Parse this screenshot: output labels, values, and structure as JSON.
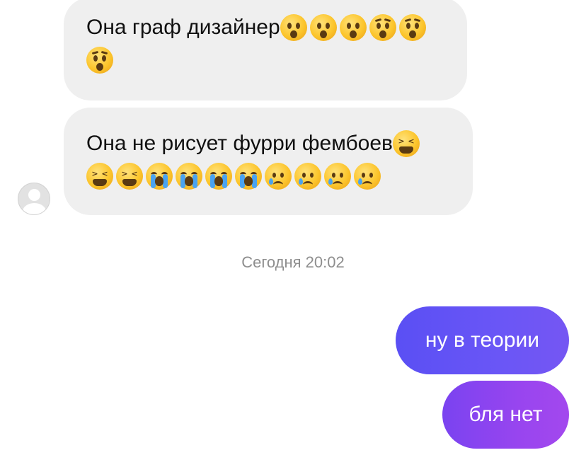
{
  "messages_in": [
    {
      "text": "Она граф дизайнер",
      "emojis_inline": [
        "hushed-face-icon",
        "hushed-face-icon",
        "hushed-face-icon",
        "astonished-face-icon",
        "astonished-face-icon"
      ],
      "emojis_row": [
        "astonished-face-icon"
      ]
    },
    {
      "text": "Она не рисует фурри фембоев",
      "emojis_inline": [
        "tired-face-icon"
      ],
      "emojis_row": [
        "tired-face-icon",
        "tired-face-icon",
        "loudly-crying-face-icon",
        "loudly-crying-face-icon",
        "loudly-crying-face-icon",
        "loudly-crying-face-icon",
        "crying-face-icon",
        "crying-face-icon",
        "crying-face-icon",
        "crying-face-icon"
      ]
    }
  ],
  "timestamp": "Сегодня 20:02",
  "messages_out": [
    {
      "text": "ну в теории"
    },
    {
      "text": "бля нет"
    }
  ],
  "colors": {
    "incoming_bubble": "#efefef",
    "outgoing_bubble_1": "#5a4ff4",
    "outgoing_bubble_2": "#9845ef",
    "timestamp_text": "#8e8e8e"
  }
}
